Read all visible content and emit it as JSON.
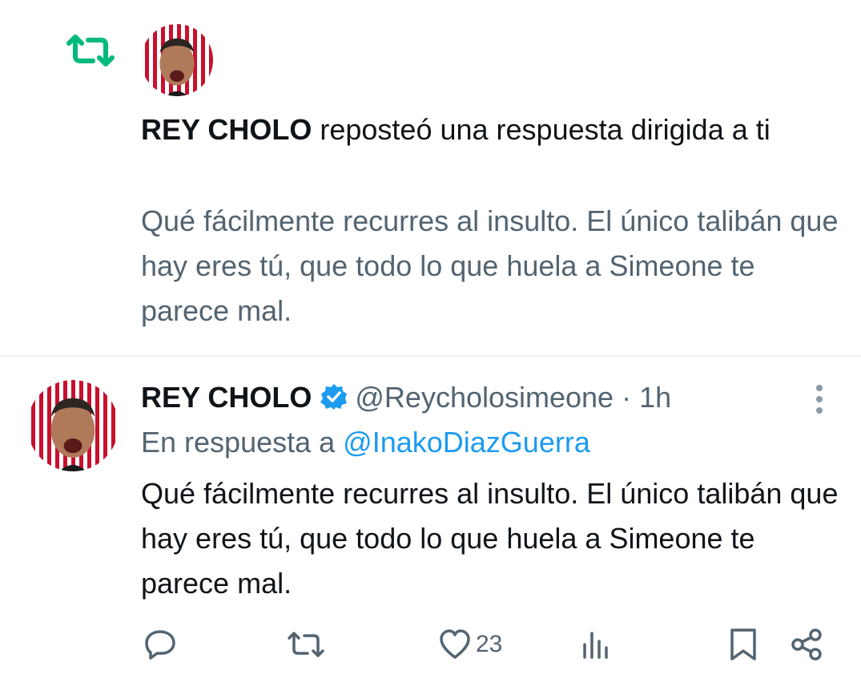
{
  "colors": {
    "repost_green": "#00ba7c",
    "secondary_text": "#536471",
    "link_blue": "#1d9bf0",
    "verified_blue": "#1d9bf0",
    "avatar_red": "#c8102e"
  },
  "notification": {
    "icon": "repost-icon",
    "actor_name": "REY CHOLO",
    "action_text": " reposteó una respuesta dirigida a ti",
    "quoted_text": "Qué fácilmente recurres al insulto. El único talibán que hay eres tú, que todo lo que huela a Simeone te parece mal."
  },
  "tweet": {
    "author_name": "REY CHOLO",
    "verified_icon": "verified-badge-icon",
    "handle": "@Reycholosimeone",
    "separator": " · ",
    "time": "1h",
    "reply_prefix": "En respuesta a ",
    "reply_to": "@InakoDiazGuerra",
    "text": "Qué fácilmente recurres al insulto. El único talibán que hay eres tú, que todo lo que huela a Simeone te parece mal.",
    "actions": {
      "reply_icon": "reply-icon",
      "repost_icon": "repost-icon",
      "like_icon": "heart-icon",
      "like_count": "23",
      "views_icon": "views-icon",
      "bookmark_icon": "bookmark-icon",
      "share_icon": "share-icon"
    }
  }
}
